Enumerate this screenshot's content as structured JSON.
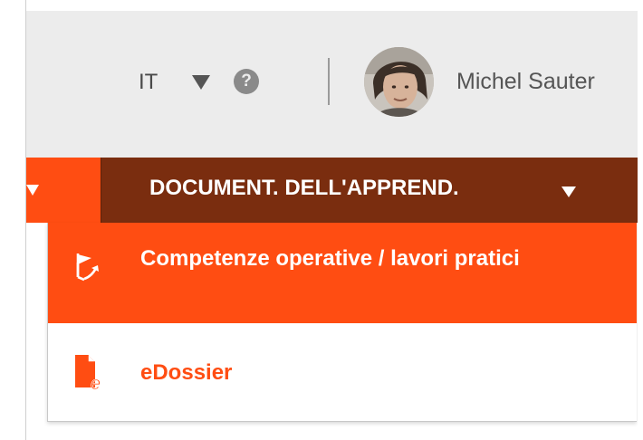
{
  "header": {
    "language": "IT",
    "help_symbol": "?",
    "user_name": "Michel Sauter"
  },
  "nav": {
    "active_label": "DOCUMENT. DELL'APPREND."
  },
  "dropdown": {
    "items": [
      {
        "label": "Competenze operative / lavori pratici",
        "icon": "flag-arrow-icon",
        "active": true
      },
      {
        "label": "eDossier",
        "icon": "edossier-file-icon",
        "active": false
      }
    ]
  },
  "colors": {
    "accent": "#ff4d12",
    "active_nav": "#7a2d0f",
    "header_bg": "#ececec"
  }
}
